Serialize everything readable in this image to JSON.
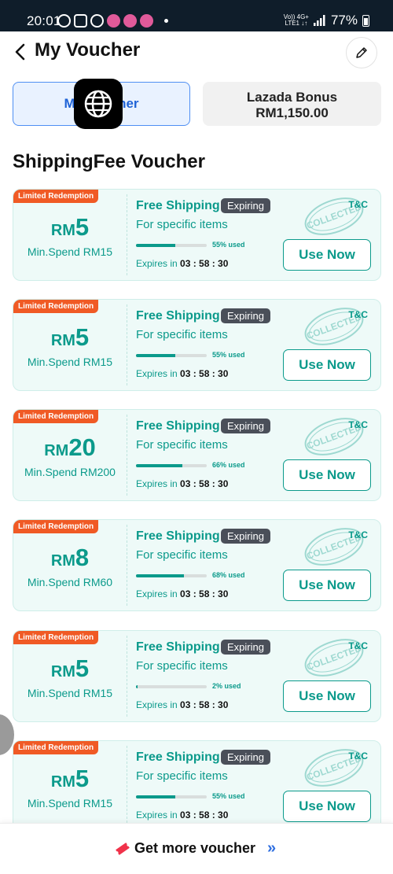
{
  "status_bar": {
    "time": "20:01",
    "net_top": "Vo)) 4G+",
    "net_bottom": "LTE1 ↓↑",
    "battery": "77%"
  },
  "header": {
    "title": "My Voucher"
  },
  "tabs": {
    "voucher_label": "My Voucher",
    "bonus_title": "Lazada Bonus",
    "bonus_amount": "RM1,150.00"
  },
  "section_title": "ShippingFee Voucher",
  "colors": {
    "accent": "#0b9a8b",
    "badge": "#f05a25",
    "tab_active": "#4f8ff3"
  },
  "vouchers": [
    {
      "badge": "Limited Redemption",
      "currency": "RM",
      "amount": "5",
      "min_spend": "Min.Spend RM15",
      "title": "Free Shipping",
      "tag": "Expiring",
      "desc": "For specific items",
      "used_pct": 55,
      "used_text": "55% used",
      "expires_label": "Expires in",
      "expires_time": "03 : 58 : 30",
      "tc": "T&C",
      "button": "Use Now"
    },
    {
      "badge": "Limited Redemption",
      "currency": "RM",
      "amount": "5",
      "min_spend": "Min.Spend RM15",
      "title": "Free Shipping",
      "tag": "Expiring",
      "desc": "For specific items",
      "used_pct": 55,
      "used_text": "55% used",
      "expires_label": "Expires in",
      "expires_time": "03 : 58 : 30",
      "tc": "T&C",
      "button": "Use Now"
    },
    {
      "badge": "Limited Redemption",
      "currency": "RM",
      "amount": "20",
      "min_spend": "Min.Spend RM200",
      "title": "Free Shipping",
      "tag": "Expiring",
      "desc": "For specific items",
      "used_pct": 66,
      "used_text": "66% used",
      "expires_label": "Expires in",
      "expires_time": "03 : 58 : 30",
      "tc": "T&C",
      "button": "Use Now"
    },
    {
      "badge": "Limited Redemption",
      "currency": "RM",
      "amount": "8",
      "min_spend": "Min.Spend RM60",
      "title": "Free Shipping",
      "tag": "Expiring",
      "desc": "For specific items",
      "used_pct": 68,
      "used_text": "68% used",
      "expires_label": "Expires in",
      "expires_time": "03 : 58 : 30",
      "tc": "T&C",
      "button": "Use Now"
    },
    {
      "badge": "Limited Redemption",
      "currency": "RM",
      "amount": "5",
      "min_spend": "Min.Spend RM15",
      "title": "Free Shipping",
      "tag": "Expiring",
      "desc": "For specific items",
      "used_pct": 2,
      "used_text": "2% used",
      "expires_label": "Expires in",
      "expires_time": "03 : 58 : 30",
      "tc": "T&C",
      "button": "Use Now"
    },
    {
      "badge": "Limited Redemption",
      "currency": "RM",
      "amount": "5",
      "min_spend": "Min.Spend RM15",
      "title": "Free Shipping",
      "tag": "Expiring",
      "desc": "For specific items",
      "used_pct": 55,
      "used_text": "55% used",
      "expires_label": "Expires in",
      "expires_time": "03 : 58 : 30",
      "tc": "T&C",
      "button": "Use Now"
    }
  ],
  "stamp_text": "COLLECTED",
  "footer": {
    "label": "Get more voucher"
  }
}
